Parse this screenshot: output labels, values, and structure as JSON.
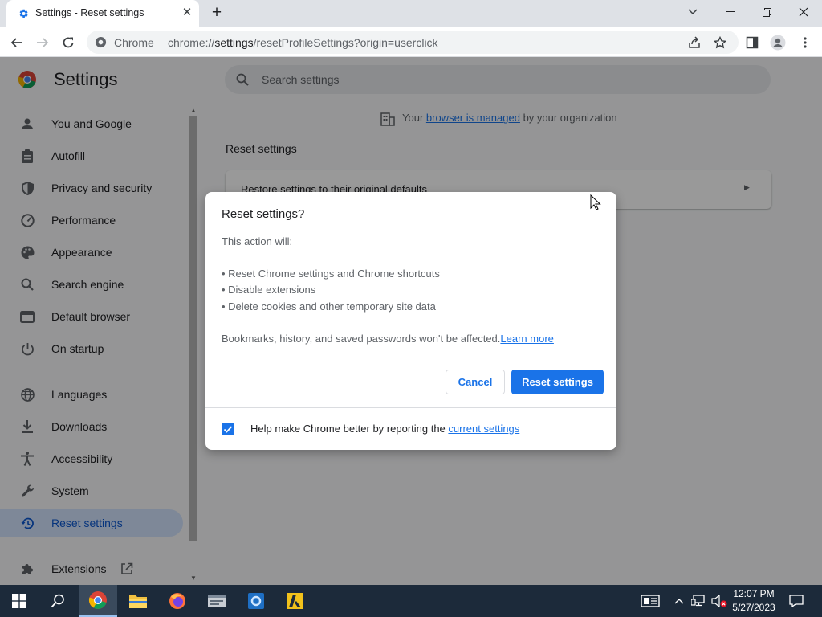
{
  "browser": {
    "tab_title": "Settings - Reset settings",
    "omnibox_chip": "Chrome",
    "url_prefix": "chrome://",
    "url_host": "settings",
    "url_path": "/resetProfileSettings?origin=userclick"
  },
  "settings": {
    "title": "Settings",
    "search_placeholder": "Search settings",
    "managed": {
      "prefix": "Your ",
      "link": "browser is managed",
      "suffix": " by your organization"
    },
    "section_title": "Reset settings",
    "card_label": "Restore settings to their original defaults",
    "sidebar": [
      {
        "label": "You and Google",
        "icon": "person-icon"
      },
      {
        "label": "Autofill",
        "icon": "clipboard-icon"
      },
      {
        "label": "Privacy and security",
        "icon": "shield-icon"
      },
      {
        "label": "Performance",
        "icon": "speedometer-icon"
      },
      {
        "label": "Appearance",
        "icon": "palette-icon"
      },
      {
        "label": "Search engine",
        "icon": "search-icon"
      },
      {
        "label": "Default browser",
        "icon": "browser-window-icon"
      },
      {
        "label": "On startup",
        "icon": "power-icon"
      },
      {
        "label": "Languages",
        "icon": "globe-icon"
      },
      {
        "label": "Downloads",
        "icon": "download-icon"
      },
      {
        "label": "Accessibility",
        "icon": "accessibility-icon"
      },
      {
        "label": "System",
        "icon": "wrench-icon"
      },
      {
        "label": "Reset settings",
        "icon": "history-icon",
        "active": true
      },
      {
        "label": "Extensions",
        "icon": "puzzle-icon"
      }
    ]
  },
  "dialog": {
    "title": "Reset settings?",
    "intro": "This action will:",
    "bullets": [
      "• Reset Chrome settings and Chrome shortcuts",
      "• Disable extensions",
      "• Delete cookies and other temporary site data"
    ],
    "note": "Bookmarks, history, and saved passwords won't be affected.",
    "note_link": "Learn more",
    "cancel_label": "Cancel",
    "reset_label": "Reset settings",
    "report_text": "Help make Chrome better by reporting the ",
    "report_link": "current settings",
    "report_checked": true
  },
  "taskbar": {
    "time": "12:07 PM",
    "date": "5/27/2023"
  },
  "colors": {
    "accent": "#1a73e8",
    "taskbar": "#1c2a3a"
  }
}
